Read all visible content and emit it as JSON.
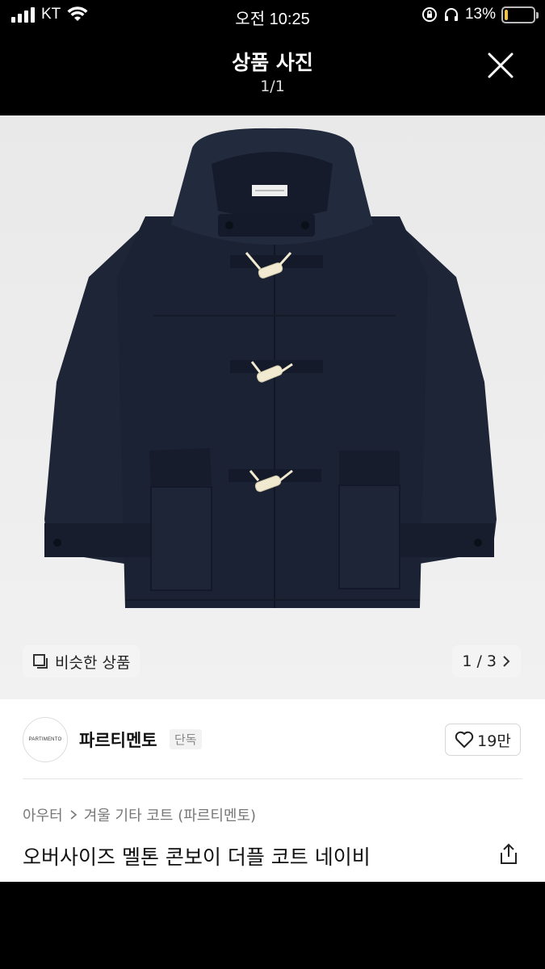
{
  "status_bar": {
    "carrier": "KT",
    "time": "오전 10:25",
    "battery_percent": "13%",
    "battery_level": 0.13,
    "battery_color": "#f5c23a"
  },
  "header": {
    "title": "상품 사진",
    "counter": "1/1",
    "close_icon": "close-icon"
  },
  "photo": {
    "subject": "navy-duffle-coat",
    "coat_color": "#1b2233",
    "toggle_color": "#f1ead0",
    "similar_label": "비슷한 상품",
    "pager_label": "1 / 3"
  },
  "seller": {
    "logo_text": "PARTIMENTO",
    "name": "파르티멘토",
    "badge": "단독",
    "likes": "19만"
  },
  "product": {
    "breadcrumb": [
      "아우터",
      "겨울 기타 코트 (파르티멘토)"
    ],
    "title": "오버사이즈 멜톤 콘보이 더플 코트 네이비"
  }
}
